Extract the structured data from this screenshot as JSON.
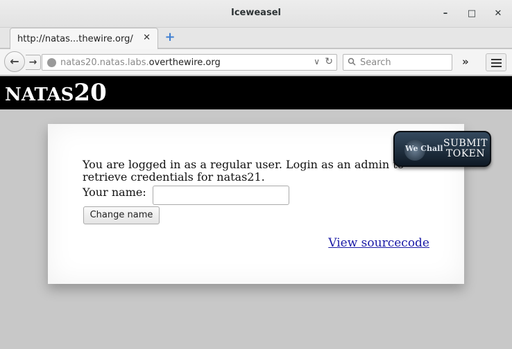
{
  "window": {
    "title": "Iceweasel",
    "minimize_glyph": "–",
    "maximize_glyph": "□",
    "close_glyph": "✕"
  },
  "tab": {
    "label": "http://natas...thewire.org/",
    "close_glyph": "✕",
    "newtab_glyph": "+"
  },
  "nav": {
    "back_glyph": "←",
    "forward_glyph": "→",
    "url_prefix": "natas20.natas.labs.",
    "url_domain": "overthewire.org",
    "dropdown_glyph": "∨",
    "reload_glyph": "↻",
    "search_placeholder": "Search",
    "overflow_glyph": "»"
  },
  "page": {
    "brand_text": "NATAS",
    "brand_num": "20",
    "message": "You are logged in as a regular user. Login as an admin to retrieve credentials for natas21.",
    "name_label": "Your name:",
    "name_value": "",
    "change_button": "Change name",
    "source_link": "View sourcecode"
  },
  "wechall": {
    "logo_text": "We Chall",
    "line1": "SUBMIT",
    "line2": "TOKEN"
  }
}
